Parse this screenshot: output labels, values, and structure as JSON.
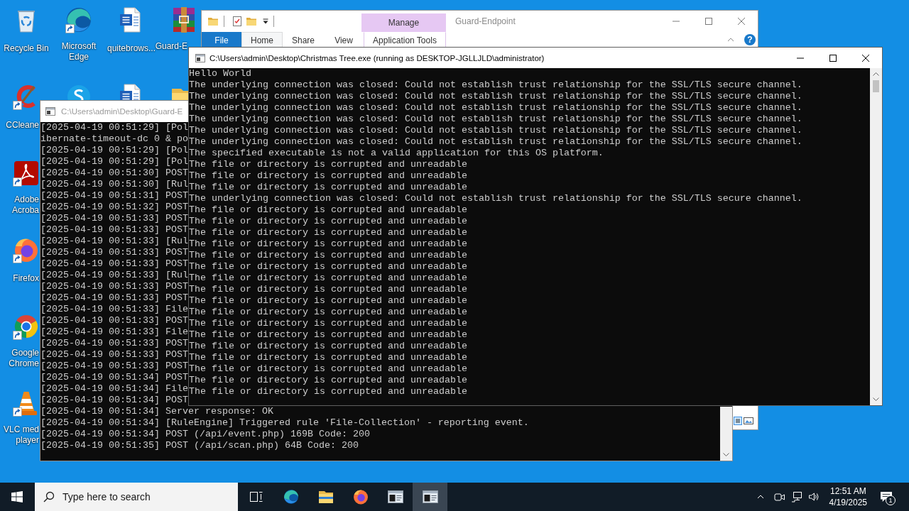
{
  "desktop_icons": [
    {
      "kind": "bin",
      "label": "Recycle Bin",
      "shortcut": false
    },
    {
      "kind": "edge",
      "label": "Microsoft\nEdge",
      "shortcut": true
    },
    {
      "kind": "doc",
      "label": "quitebrows...",
      "shortcut": false
    },
    {
      "kind": "archive",
      "label": "Guard-E",
      "shortcut": false
    },
    {
      "kind": "cleaner",
      "label": "CCleane",
      "shortcut": true
    },
    {
      "kind": "skype"
    },
    {
      "kind": "doc"
    },
    {
      "kind": "folder"
    },
    {
      "kind": "pdf",
      "label": "Adobe\nAcroba",
      "shortcut": true
    },
    {
      "kind": "firefox",
      "label": "Firefox",
      "shortcut": true
    },
    {
      "kind": "chrome",
      "label": "Google\nChrome",
      "shortcut": true
    },
    {
      "kind": "vlc",
      "label": "VLC med\nplayer",
      "shortcut": true
    }
  ],
  "explorer": {
    "context_tab": "Manage",
    "title": "Guard-Endpoint",
    "tabs": [
      {
        "label": "File",
        "kind": "file",
        "selected": false
      },
      {
        "label": "Home",
        "kind": "tab",
        "selected": true
      },
      {
        "label": "Share",
        "kind": "tab",
        "selected": false
      },
      {
        "label": "View",
        "kind": "tab",
        "selected": false
      },
      {
        "label": "Application Tools",
        "kind": "context",
        "selected": false
      }
    ],
    "help": "?"
  },
  "back_console": {
    "title": "C:\\Users\\admin\\Desktop\\Guard-E",
    "lines": [
      "[2025-04-19 00:51:29] [Pol",
      "ibernate-timeout-dc 0 & po",
      "[2025-04-19 00:51:29] [Pol",
      "[2025-04-19 00:51:29] [Pol",
      "[2025-04-19 00:51:30] POST",
      "[2025-04-19 00:51:30] [Rul",
      "[2025-04-19 00:51:31] POST",
      "[2025-04-19 00:51:32] POST",
      "[2025-04-19 00:51:33] POST",
      "[2025-04-19 00:51:33] POST",
      "[2025-04-19 00:51:33] [Rul",
      "[2025-04-19 00:51:33] POST",
      "[2025-04-19 00:51:33] POST",
      "[2025-04-19 00:51:33] [Rul",
      "[2025-04-19 00:51:33] POST",
      "[2025-04-19 00:51:33] POST",
      "[2025-04-19 00:51:33] File",
      "[2025-04-19 00:51:33] POST",
      "[2025-04-19 00:51:33] File",
      "[2025-04-19 00:51:33] POST",
      "[2025-04-19 00:51:33] POST",
      "[2025-04-19 00:51:33] POST",
      "[2025-04-19 00:51:34] POST",
      "[2025-04-19 00:51:34] File",
      "[2025-04-19 00:51:34] POST",
      "[2025-04-19 00:51:34] Server response: OK",
      "[2025-04-19 00:51:34] [RuleEngine] Triggered rule 'File-Collection' - reporting event.",
      "[2025-04-19 00:51:34] POST (/api/event.php) 169B Code: 200",
      "[2025-04-19 00:51:35] POST (/api/scan.php) 64B Code: 200"
    ]
  },
  "front_console": {
    "title": "C:\\Users\\admin\\Desktop\\Christmas Tree.exe (running as DESKTOP-JGLLJLD\\administrator)",
    "lines": [
      "Hello World",
      "The underlying connection was closed: Could not establish trust relationship for the SSL/TLS secure channel.",
      "The underlying connection was closed: Could not establish trust relationship for the SSL/TLS secure channel.",
      "The underlying connection was closed: Could not establish trust relationship for the SSL/TLS secure channel.",
      "The underlying connection was closed: Could not establish trust relationship for the SSL/TLS secure channel.",
      "The underlying connection was closed: Could not establish trust relationship for the SSL/TLS secure channel.",
      "The underlying connection was closed: Could not establish trust relationship for the SSL/TLS secure channel.",
      "The specified executable is not a valid application for this OS platform.",
      "The file or directory is corrupted and unreadable",
      "The file or directory is corrupted and unreadable",
      "The file or directory is corrupted and unreadable",
      "The underlying connection was closed: Could not establish trust relationship for the SSL/TLS secure channel.",
      "The file or directory is corrupted and unreadable",
      "The file or directory is corrupted and unreadable",
      "The file or directory is corrupted and unreadable",
      "The file or directory is corrupted and unreadable",
      "The file or directory is corrupted and unreadable",
      "The file or directory is corrupted and unreadable",
      "The file or directory is corrupted and unreadable",
      "The file or directory is corrupted and unreadable",
      "The file or directory is corrupted and unreadable",
      "The file or directory is corrupted and unreadable",
      "The file or directory is corrupted and unreadable",
      "The file or directory is corrupted and unreadable",
      "The file or directory is corrupted and unreadable",
      "The file or directory is corrupted and unreadable",
      "The file or directory is corrupted and unreadable",
      "The file or directory is corrupted and unreadable",
      "The file or directory is corrupted and unreadable"
    ]
  },
  "taskbar": {
    "search": {
      "placeholder": "Type here to search"
    },
    "apps": [
      {
        "kind": "edge",
        "selected": false
      },
      {
        "kind": "folder",
        "selected": false
      },
      {
        "kind": "firefox",
        "selected": false
      },
      {
        "kind": "console",
        "selected": false
      },
      {
        "kind": "console",
        "selected": true
      }
    ],
    "clock": {
      "time": "12:51 AM",
      "date": "4/19/2025"
    },
    "notifications": {
      "count": "1"
    }
  }
}
